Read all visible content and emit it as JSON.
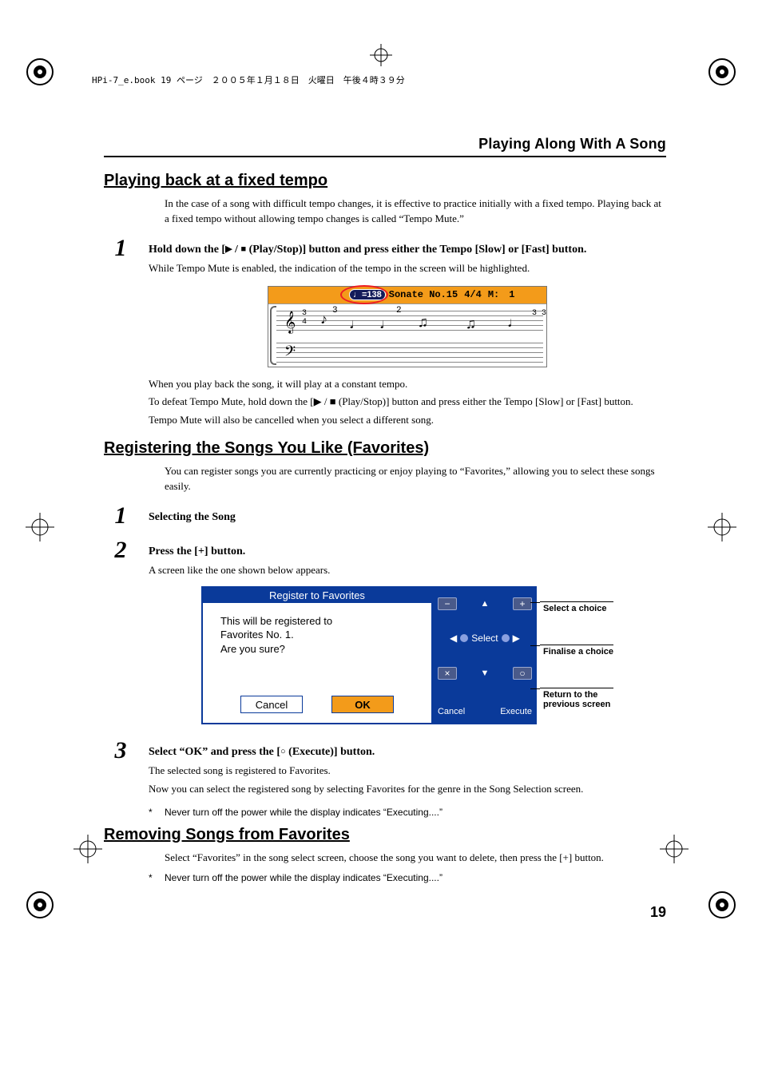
{
  "meta_line": "HPi-7_e.book 19 ページ　２００５年１月１８日　火曜日　午後４時３９分",
  "chapter": "Playing Along With A Song",
  "page_number": "19",
  "sections": {
    "tempo": {
      "title": "Playing back at a fixed tempo",
      "intro1": "In the case of a song with difficult tempo changes, it is effective to practice initially with a fixed tempo. Playing back at a fixed tempo without allowing tempo changes is called “Tempo Mute.”",
      "step1_pre": "Hold down the [",
      "step1_post": " (Play/Stop)] button and press either the Tempo [Slow] or [Fast] button.",
      "step1_body": "While Tempo Mute is enabled, the indication of the tempo in the screen will be highlighted.",
      "after1": "When you play back the song, it will play at a constant tempo.",
      "after2_pre": "To defeat Tempo Mute, hold down the [",
      "after2_post": " (Play/Stop)] button and press either the Tempo [Slow] or [Fast] button.",
      "after3": "Tempo Mute will also be cancelled when you select a different song.",
      "fig": {
        "tempo_badge": "♩=138",
        "song": "Sonate No.15",
        "time": "4/4",
        "meas_label": "M:",
        "meas_val": "1"
      }
    },
    "fav": {
      "title": "Registering the Songs You Like (Favorites)",
      "intro": "You can register songs you are currently practicing or enjoy playing to “Favorites,” allowing you to select these songs easily.",
      "step1_title": "Selecting the Song",
      "step2_title": "Press the [+] button.",
      "step2_body": "A screen like the one shown below appears.",
      "dlg": {
        "title": "Register to Favorites",
        "line1": "This will be registered to",
        "line2": "Favorites No. 1.",
        "line3": "Are you sure?",
        "cancel": "Cancel",
        "ok": "OK"
      },
      "nav": {
        "minus": "−",
        "up": "▲",
        "plus": "+",
        "left": "◀",
        "select": "Select",
        "right": "▶",
        "x": "×",
        "down": "▼",
        "o": "○",
        "cancel": "Cancel",
        "execute": "Execute"
      },
      "nav_labels": {
        "a": "Select a choice",
        "b": "Finalise a choice",
        "c1": "Return to the",
        "c2": "previous screen"
      },
      "step3_pre": "Select “OK” and press the [",
      "step3_post": " (Execute)] button.",
      "step3_body1": "The selected song is registered to Favorites.",
      "step3_body2": "Now you can select the registered song by selecting Favorites for the genre in the Song Selection screen.",
      "note": "Never turn off the power while the display indicates “Executing....”"
    },
    "remove": {
      "title": "Removing Songs from Favorites",
      "body": "Select “Favorites” in the song select screen, choose the song you want to delete, then press the [+] button.",
      "note": "Never turn off the power while the display indicates “Executing....”"
    }
  }
}
